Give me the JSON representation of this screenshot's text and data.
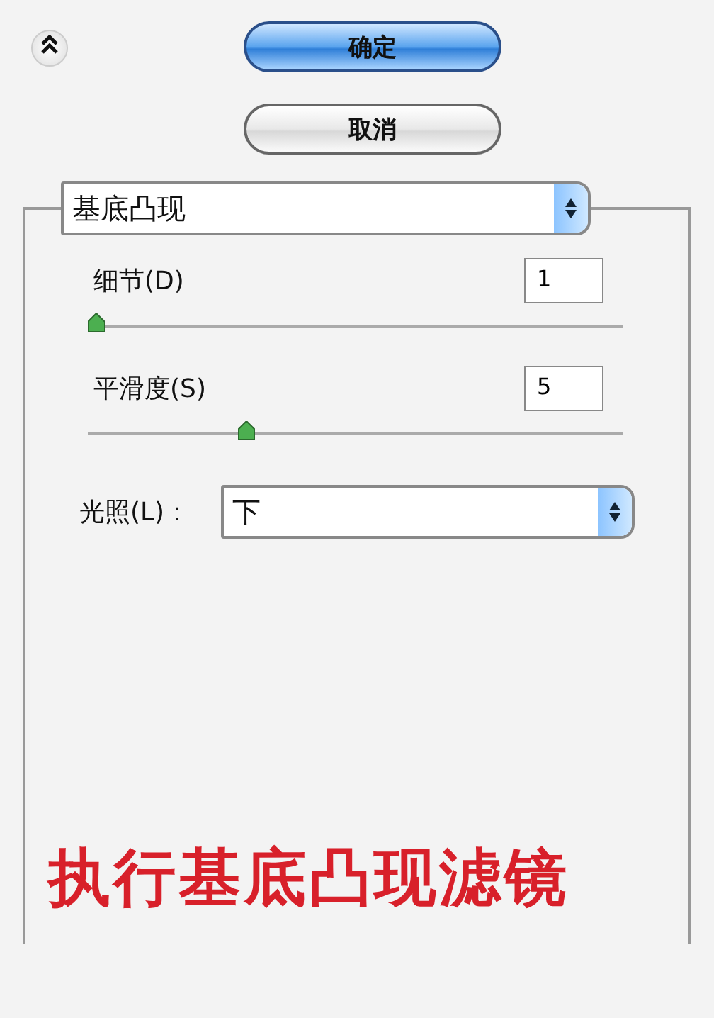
{
  "buttons": [
    {
      "label": "确定",
      "kind": "default"
    },
    {
      "label": "取消",
      "kind": "normal"
    }
  ],
  "filter_select": {
    "value": "基底凸现"
  },
  "sliders": [
    {
      "label": "细节(D)",
      "value": "1",
      "level": 0
    },
    {
      "label": "平滑度(S)",
      "value": "5",
      "level": 0.29
    }
  ],
  "lighting": {
    "label": "光照(L)：",
    "value": "下"
  },
  "caption": "执行基底凸现滤镜"
}
